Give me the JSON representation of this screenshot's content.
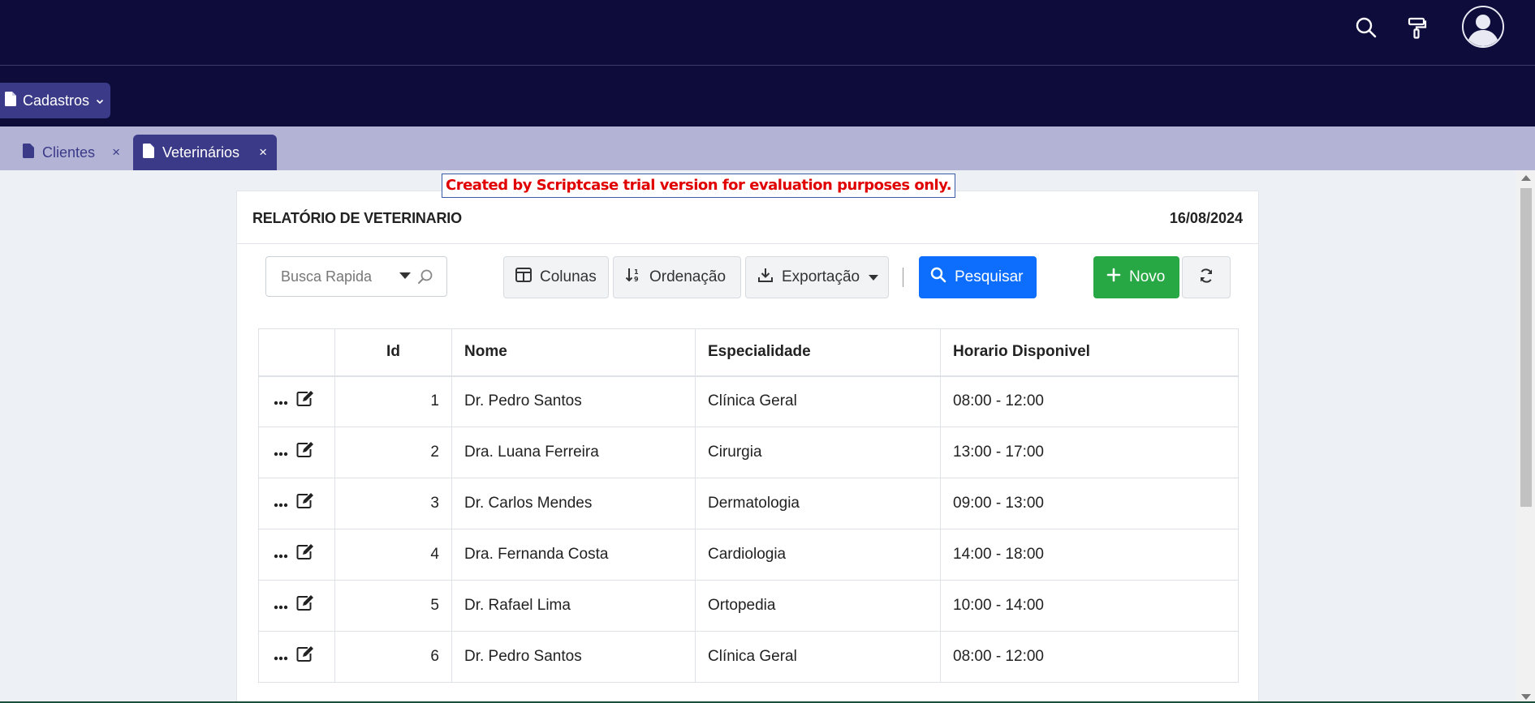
{
  "topbar": {
    "icons": [
      "search-icon",
      "paint-roller-icon",
      "user-avatar-icon"
    ],
    "menu": {
      "label": "Cadastros",
      "icon": "file-icon",
      "chevron": "chevron-down-icon"
    }
  },
  "tabs": [
    {
      "label": "Clientes",
      "close": "×",
      "active": false
    },
    {
      "label": "Veterinários",
      "close": "×",
      "active": true
    }
  ],
  "trial_notice": "Created by Scriptcase trial version for evaluation purposes only.",
  "report": {
    "title": "RELATÓRIO DE VETERINARIO",
    "date": "16/08/2024"
  },
  "toolbar": {
    "search_placeholder": "Busca Rapida",
    "columns_label": "Colunas",
    "sort_label": "Ordenação",
    "export_label": "Exportação",
    "search_button": "Pesquisar",
    "new_button": "Novo"
  },
  "colors": {
    "topbar": "#0d0c3b",
    "accent": "#3b3a88",
    "tabbar": "#b3b3d6",
    "primary": "#0d6efd",
    "success": "#28a745",
    "trial_text": "#e00000"
  },
  "table": {
    "headers": [
      "",
      "Id",
      "Nome",
      "Especialidade",
      "Horario Disponivel"
    ],
    "rows": [
      {
        "id": "1",
        "nome": "Dr. Pedro Santos",
        "especialidade": "Clínica Geral",
        "horario": "08:00 - 12:00"
      },
      {
        "id": "2",
        "nome": "Dra. Luana Ferreira",
        "especialidade": "Cirurgia",
        "horario": "13:00 - 17:00"
      },
      {
        "id": "3",
        "nome": "Dr. Carlos Mendes",
        "especialidade": "Dermatologia",
        "horario": "09:00 - 13:00"
      },
      {
        "id": "4",
        "nome": "Dra. Fernanda Costa",
        "especialidade": "Cardiologia",
        "horario": "14:00 - 18:00"
      },
      {
        "id": "5",
        "nome": "Dr. Rafael Lima",
        "especialidade": "Ortopedia",
        "horario": "10:00 - 14:00"
      },
      {
        "id": "6",
        "nome": "Dr. Pedro Santos",
        "especialidade": "Clínica Geral",
        "horario": "08:00 - 12:00"
      }
    ]
  }
}
